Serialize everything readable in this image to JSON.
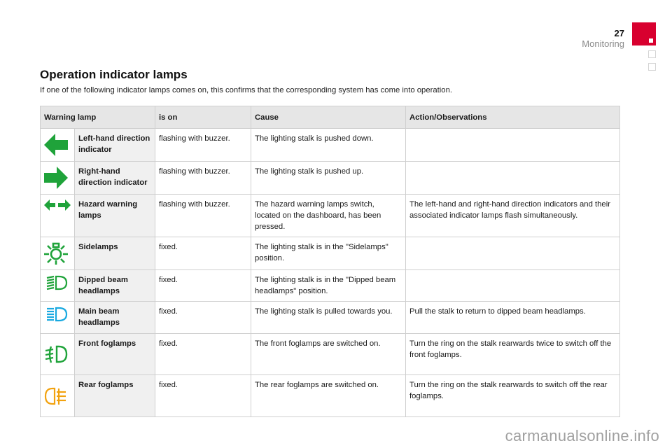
{
  "header": {
    "page_number": "27",
    "section": "Monitoring",
    "accent_color": "#d8002f"
  },
  "title": "Operation indicator lamps",
  "intro": "If one of the following indicator lamps comes on, this confirms that the corresponding system has come into operation.",
  "table": {
    "columns": [
      "Warning lamp",
      "is on",
      "Cause",
      "Action/Observations"
    ],
    "rows": [
      {
        "icon": "left-arrow-icon",
        "icon_color": "#1fa33a",
        "name": "Left-hand direction indicator",
        "is_on": "flashing with buzzer.",
        "cause": "The lighting stalk is pushed down.",
        "action": ""
      },
      {
        "icon": "right-arrow-icon",
        "icon_color": "#1fa33a",
        "name": "Right-hand direction indicator",
        "is_on": "flashing with buzzer.",
        "cause": "The lighting stalk is pushed up.",
        "action": ""
      },
      {
        "icon": "hazard-arrows-icon",
        "icon_color": "#1fa33a",
        "name": "Hazard warning lamps",
        "is_on": "flashing with buzzer.",
        "cause": "The hazard warning lamps switch, located on the dashboard, has been pressed.",
        "action": "The left-hand and right-hand direction indicators and their associated indicator lamps flash simultaneously."
      },
      {
        "icon": "sidelamps-icon",
        "icon_color": "#1fa33a",
        "name": "Sidelamps",
        "is_on": "fixed.",
        "cause": "The lighting stalk is in the \"Sidelamps\" position.",
        "action": ""
      },
      {
        "icon": "dipped-beam-icon",
        "icon_color": "#1fa33a",
        "name": "Dipped beam headlamps",
        "is_on": "fixed.",
        "cause": "The lighting stalk is in the \"Dipped beam headlamps\" position.",
        "action": ""
      },
      {
        "icon": "main-beam-icon",
        "icon_color": "#19a9e0",
        "name": "Main beam headlamps",
        "is_on": "fixed.",
        "cause": "The lighting stalk is pulled towards you.",
        "action": "Pull the stalk to return to dipped beam headlamps."
      },
      {
        "icon": "front-foglamps-icon",
        "icon_color": "#1fa33a",
        "name": "Front foglamps",
        "is_on": "fixed.",
        "cause": "The front foglamps are switched on.",
        "action": "Turn the ring on the stalk rearwards twice to switch off the front foglamps."
      },
      {
        "icon": "rear-foglamps-icon",
        "icon_color": "#f2a20f",
        "name": "Rear foglamps",
        "is_on": "fixed.",
        "cause": "The rear foglamps are switched on.",
        "action": "Turn the ring on the stalk rearwards to switch off the rear foglamps."
      }
    ]
  },
  "watermark": "carmanualsonline.info"
}
